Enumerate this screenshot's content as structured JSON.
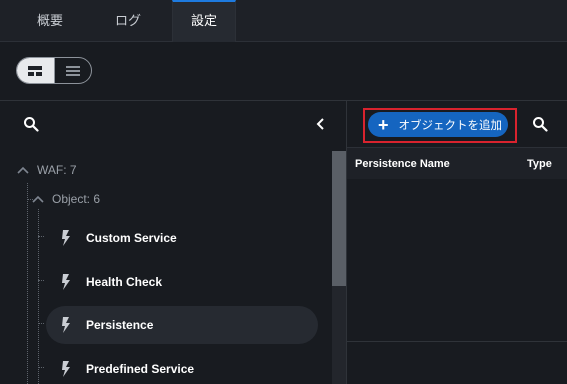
{
  "tabs": [
    {
      "label": "概要",
      "active": false
    },
    {
      "label": "ログ",
      "active": false
    },
    {
      "label": "設定",
      "active": true
    }
  ],
  "view_toggle": {
    "options": [
      "card-view-icon",
      "list-view-icon"
    ],
    "selected": "card-view-icon"
  },
  "tree": {
    "root": {
      "label": "WAF: 7"
    },
    "group": {
      "label": "Object: 6"
    },
    "items": [
      {
        "label": "Custom Service",
        "selected": false
      },
      {
        "label": "Health Check",
        "selected": false
      },
      {
        "label": "Persistence",
        "selected": true
      },
      {
        "label": "Predefined Service",
        "selected": false
      }
    ]
  },
  "toolbar": {
    "add_label": "オブジェクトを追加"
  },
  "table": {
    "columns": [
      "Persistence Name",
      "Type"
    ]
  },
  "colors": {
    "accent": "#1565c0",
    "highlight_outline": "#d9232e",
    "background": "#181b20"
  }
}
